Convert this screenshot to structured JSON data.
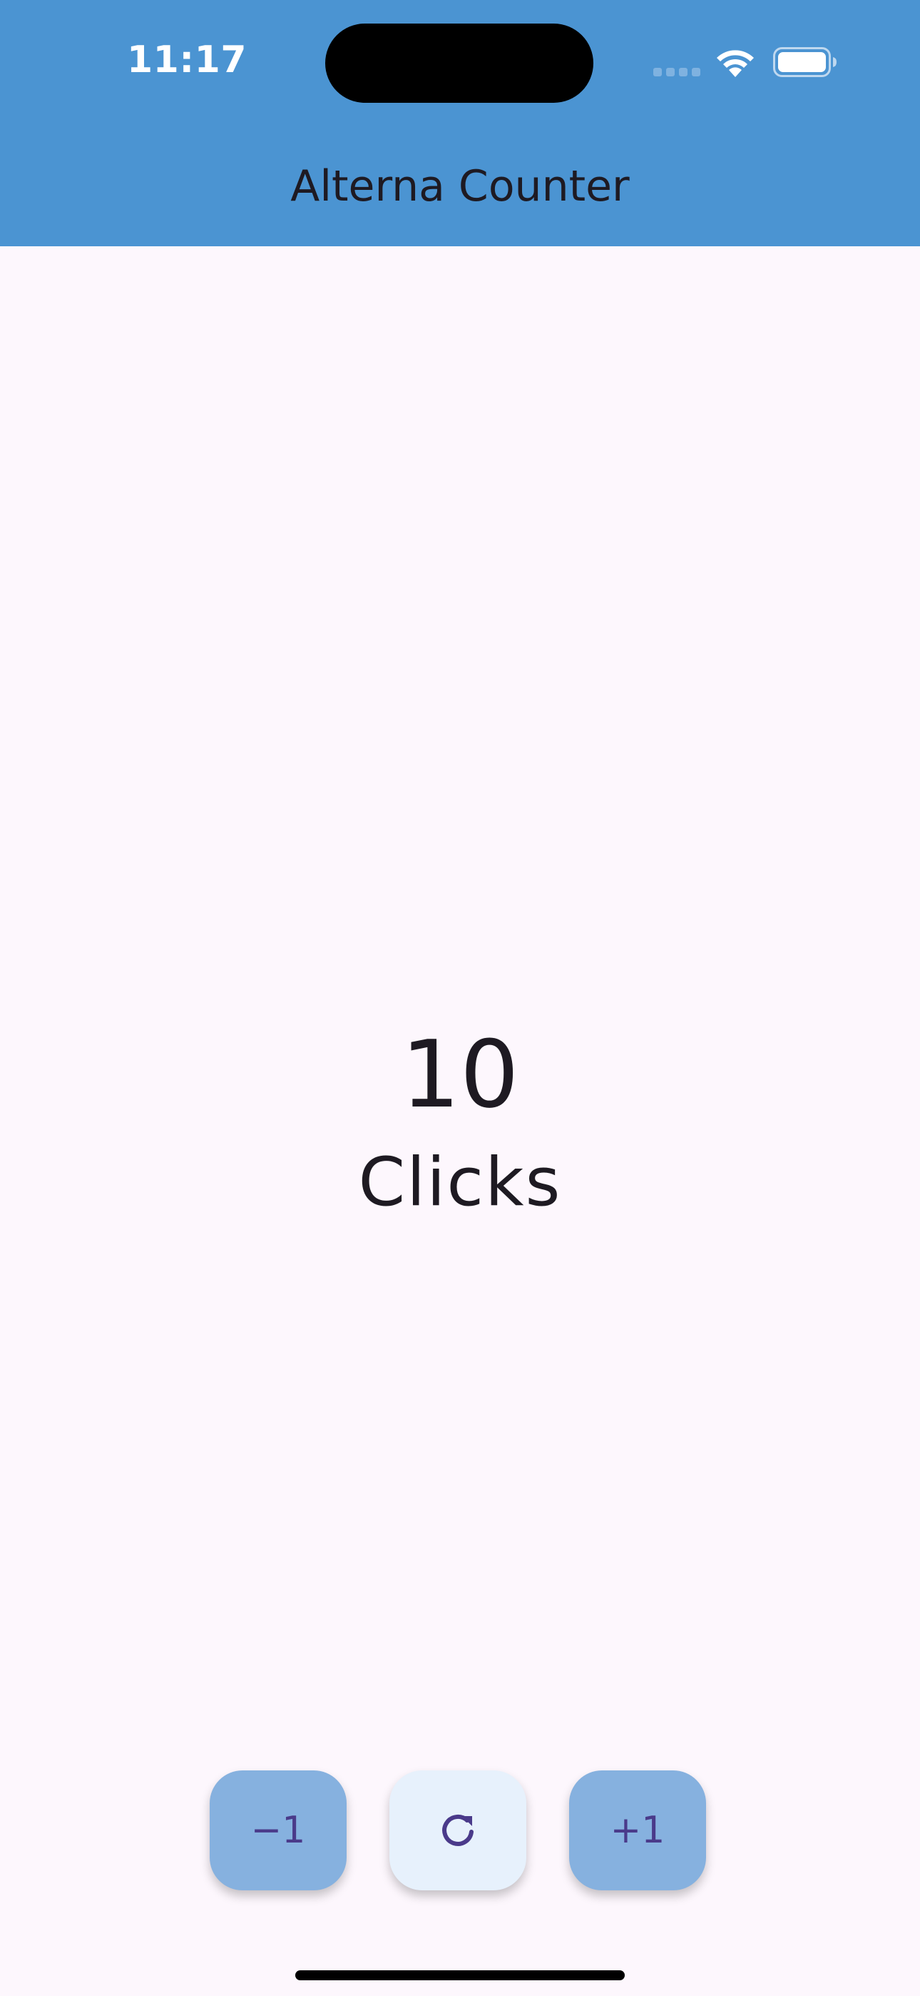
{
  "status_bar": {
    "time": "11:17",
    "icons": [
      "cellular-signal-icon",
      "wifi-icon",
      "battery-icon"
    ]
  },
  "app_bar": {
    "title": "Alterna Counter"
  },
  "counter": {
    "value": "10",
    "label": "Clicks"
  },
  "actions": {
    "decrement_label": "−1",
    "reset_icon": "refresh-icon",
    "increment_label": "+1"
  },
  "colors": {
    "app_bar": "#4B94D2",
    "background": "#FDF7FD",
    "fab_primary": "#86B1DF",
    "fab_secondary": "#E7F1FC",
    "fab_foreground": "#4A3A8A",
    "text": "#1E1A22"
  }
}
